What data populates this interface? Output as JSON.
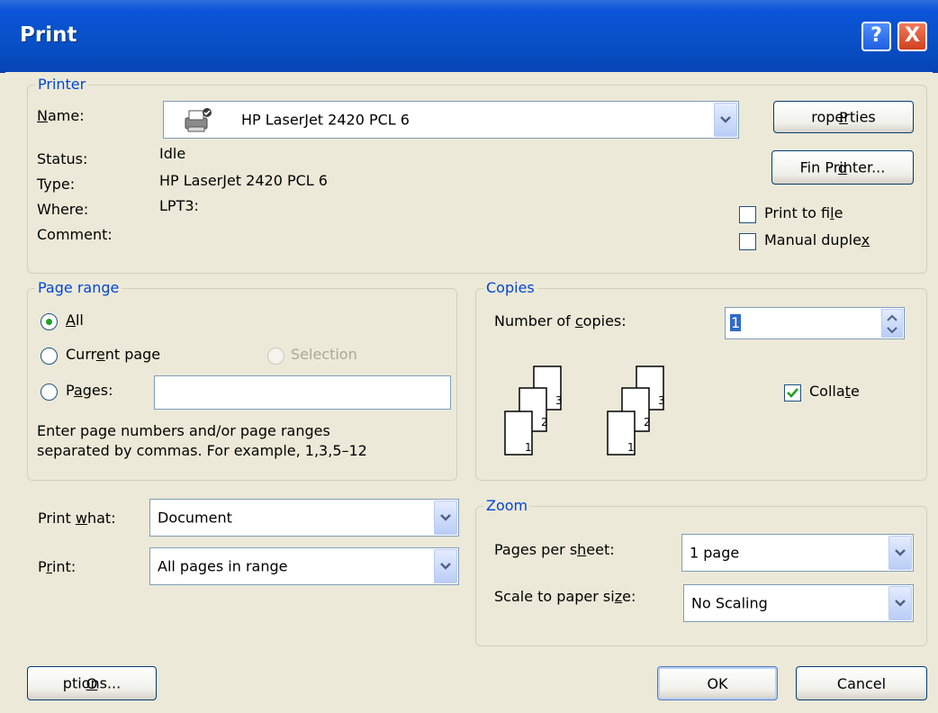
{
  "window": {
    "title": "Print",
    "help_glyph": "?",
    "close_glyph": "X"
  },
  "printer": {
    "legend": "Printer",
    "name_label": "Name:",
    "name_value": "HP LaserJet 2420 PCL 6",
    "status_label": "Status:",
    "status_value": "Idle",
    "type_label": "Type:",
    "type_value": "HP LaserJet 2420 PCL 6",
    "where_label": "Where:",
    "where_value": "LPT3:",
    "comment_label": "Comment:",
    "properties_button": "Properties",
    "find_printer_button": "Find Printer...",
    "print_to_file": {
      "label": "Print to file",
      "checked": false
    },
    "manual_duplex": {
      "label": "Manual duplex",
      "checked": false
    }
  },
  "page_range": {
    "legend": "Page range",
    "all_label": "All",
    "current_page_label": "Current page",
    "selection_label": "Selection",
    "pages_label": "Pages:",
    "pages_value": "",
    "selected": "all",
    "hint_line1": "Enter page numbers and/or page ranges",
    "hint_line2": "separated by commas.  For example, 1,3,5–12"
  },
  "copies": {
    "legend": "Copies",
    "number_label": "Number of copies:",
    "number_value": "1",
    "collate": {
      "label": "Collate",
      "checked": true
    },
    "page_numbers": [
      "1",
      "2",
      "3"
    ]
  },
  "print_what": {
    "label": "Print what:",
    "value": "Document"
  },
  "print": {
    "label": "Print:",
    "value": "All pages in range"
  },
  "zoom": {
    "legend": "Zoom",
    "pages_per_sheet_label": "Pages per sheet:",
    "pages_per_sheet_value": "1 page",
    "scale_label": "Scale to paper size:",
    "scale_value": "No Scaling"
  },
  "buttons": {
    "options": "Options...",
    "ok": "OK",
    "cancel": "Cancel"
  },
  "icons": {
    "printer": "printer-icon",
    "dropdown": "chevron-down-icon",
    "spinner": "spin-updown-icon",
    "check": "checkmark-icon"
  },
  "colors": {
    "titlebar": "#0A54D8",
    "legend_text": "#0046D5",
    "dialog_bg": "#ECE9D8",
    "radio_dot": "#21A121"
  }
}
